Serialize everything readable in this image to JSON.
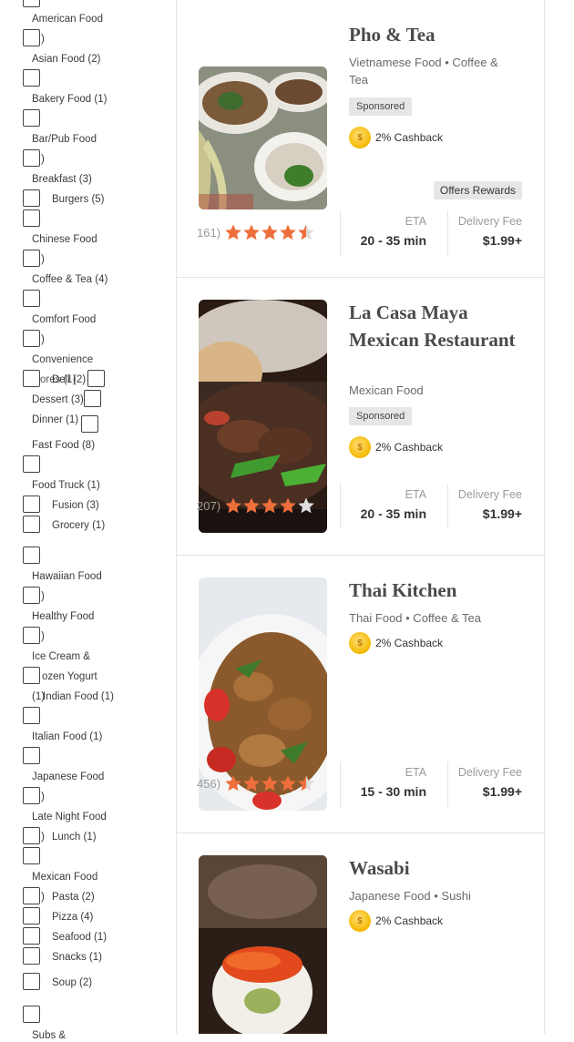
{
  "filters": {
    "categories": [
      {
        "label": "American Food",
        "frag": ")"
      },
      {
        "label": "Asian Food (2)"
      },
      {
        "label": "Bakery Food (1)"
      },
      {
        "label": "Bar/Pub Food",
        "frag": ")"
      },
      {
        "label": "Breakfast (3)"
      },
      {
        "label": "Burgers (5)"
      },
      {
        "label": "Chinese Food",
        "frag": ")"
      },
      {
        "label": "Coffee & Tea (4)"
      },
      {
        "label": "Comfort Food",
        "frag": ")"
      },
      {
        "label": "Convenience"
      },
      {
        "label": "Deli (2)"
      },
      {
        "label": "Dessert (3)"
      },
      {
        "label": "Dinner (1)"
      },
      {
        "label": "Fast Food (8)"
      },
      {
        "label": "Food Truck (1)"
      },
      {
        "label": "Fusion (3)"
      },
      {
        "label": "Grocery (1)"
      },
      {
        "label": "Hawaiian Food",
        "frag": ")"
      },
      {
        "label": "Healthy Food",
        "frag": ")"
      },
      {
        "label": "Ice Cream &"
      },
      {
        "label": "ozen Yogurt"
      },
      {
        "label": "Indian Food (1)"
      },
      {
        "label": "Italian Food (1)"
      },
      {
        "label": "Japanese Food",
        "frag": ")"
      },
      {
        "label": "Late Night Food",
        "frag": ")"
      },
      {
        "label": "Lunch (1)"
      },
      {
        "label": "Mexican Food",
        "frag": ")"
      },
      {
        "label": "Pasta (2)"
      },
      {
        "label": "Pizza (4)"
      },
      {
        "label": "Seafood (1)"
      },
      {
        "label": "Snacks (1)"
      },
      {
        "label": "Soup (2)"
      },
      {
        "label": "Subs &"
      }
    ],
    "stray_fragments": [
      "ores (1)",
      "(1)"
    ]
  },
  "restaurants": [
    {
      "name": "Pho & Tea",
      "cuisine": "Vietnamese Food • Coffee & Tea",
      "sponsored": "Sponsored",
      "cashback": "2% Cashback",
      "offers": "Offers Rewards",
      "review_count": "161)",
      "stars": 4.5,
      "eta_label": "ETA",
      "eta": "20 - 35 min",
      "fee_label": "Delivery Fee",
      "fee": "$1.99+"
    },
    {
      "name": "La Casa Maya Mexican Restaurant",
      "cuisine": "Mexican Food",
      "sponsored": "Sponsored",
      "cashback": "2% Cashback",
      "review_count": "207)",
      "stars": 4,
      "eta_label": "ETA",
      "eta": "20 - 35 min",
      "fee_label": "Delivery Fee",
      "fee": "$1.99+"
    },
    {
      "name": "Thai Kitchen",
      "cuisine": "Thai Food • Coffee & Tea",
      "cashback": "2% Cashback",
      "review_count": "456)",
      "stars": 4.5,
      "eta_label": "ETA",
      "eta": "15 - 30 min",
      "fee_label": "Delivery Fee",
      "fee": "$1.99+"
    },
    {
      "name": "Wasabi",
      "cuisine": "Japanese Food • Sushi",
      "cashback": "2% Cashback"
    }
  ],
  "colors": {
    "star": "#ef6f3c",
    "star_empty": "#dddddd",
    "coin": "#f5b800"
  }
}
